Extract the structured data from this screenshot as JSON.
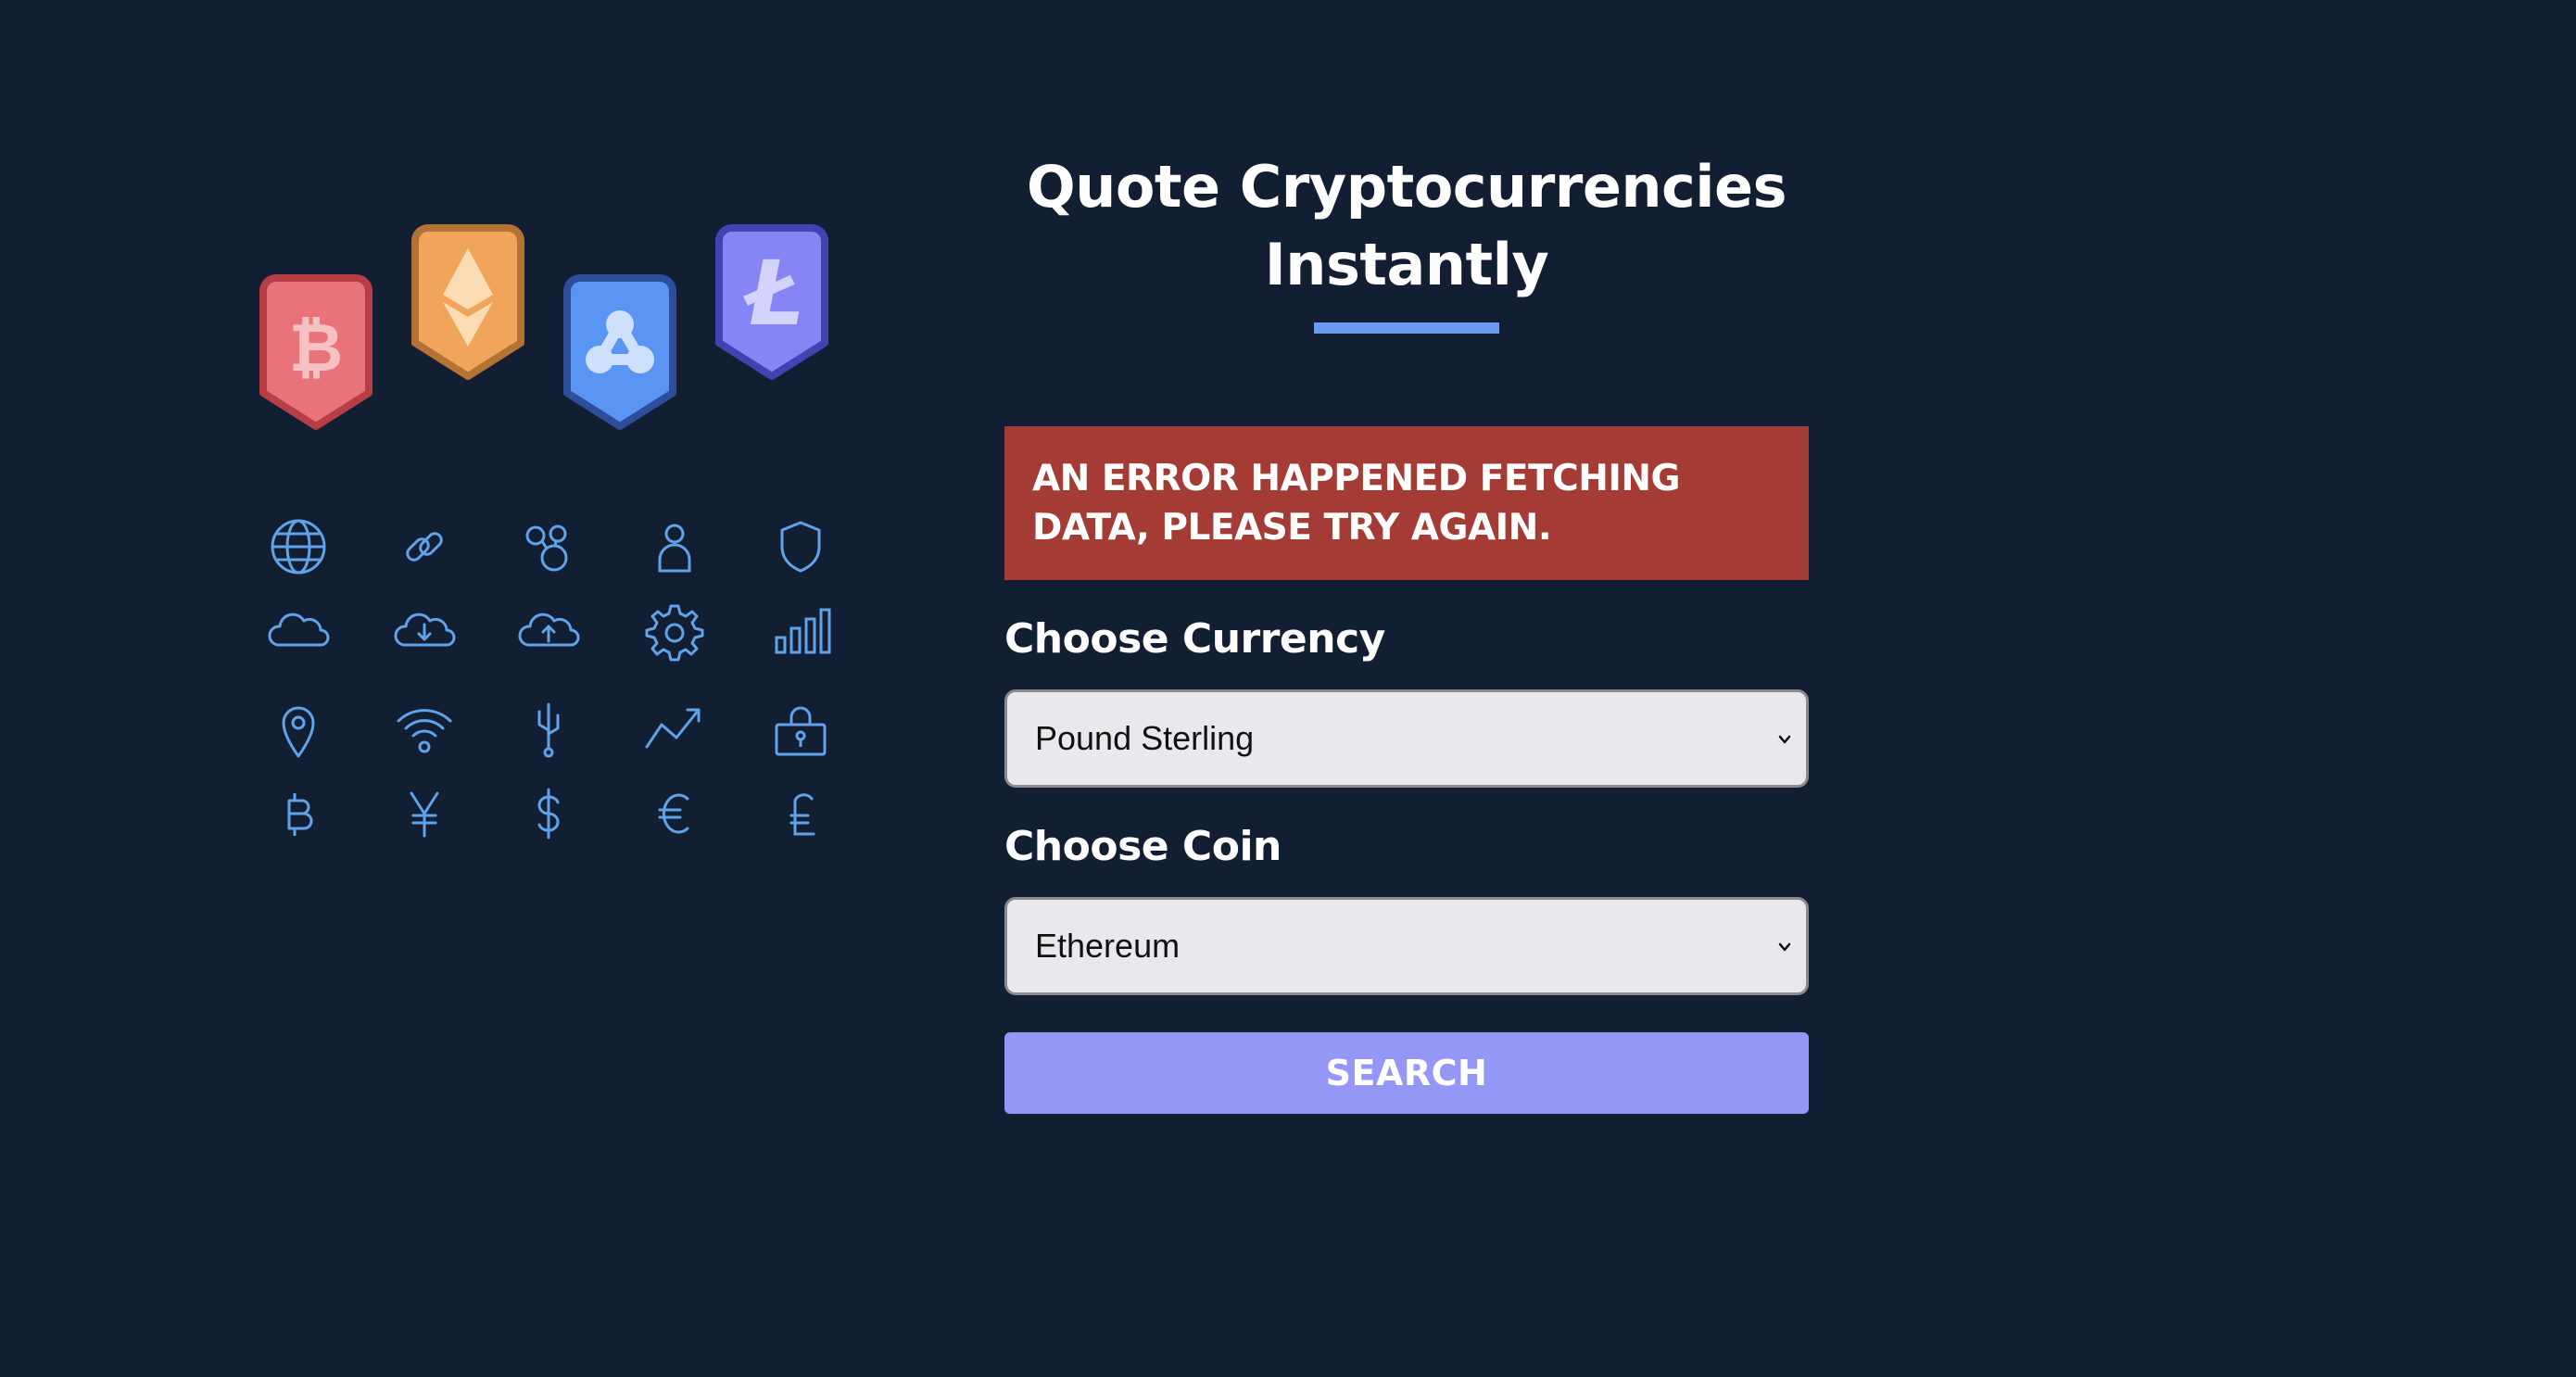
{
  "page": {
    "title_line1": "Quote Cryptocurrencies",
    "title_line2": "Instantly"
  },
  "error": {
    "message_line1": "AN ERROR HAPPENED FETCHING",
    "message_line2": "DATA, PLEASE TRY AGAIN."
  },
  "form": {
    "currency_label": "Choose Currency",
    "currency_selected": "Pound Sterling",
    "coin_label": "Choose Coin",
    "coin_selected": "Ethereum",
    "search_label": "SEARCH"
  },
  "badges": [
    {
      "name": "bitcoin-badge-icon",
      "color": "#e8737a"
    },
    {
      "name": "ethereum-badge-icon",
      "color": "#f0a55a"
    },
    {
      "name": "ripple-badge-icon",
      "color": "#5b95f3"
    },
    {
      "name": "litecoin-badge-icon",
      "color": "#8785f5"
    }
  ],
  "icon_grid": [
    [
      "globe-icon",
      "link-icon",
      "network-icon",
      "user-icon",
      "shield-icon"
    ],
    [
      "cloud-icon",
      "cloud-download-icon",
      "cloud-upload-icon",
      "gear-icon",
      "bar-chart-icon"
    ],
    [
      "location-pin-icon",
      "wifi-icon",
      "usb-icon",
      "trend-up-icon",
      "lock-icon"
    ],
    [
      "bitcoin-icon",
      "yen-icon",
      "dollar-icon",
      "euro-icon",
      "pound-icon"
    ]
  ],
  "colors": {
    "background": "#121f33",
    "accent": "#6b9bf0",
    "error": "#a53b35",
    "button": "#9497f6",
    "icon_stroke": "#5fa3ea"
  }
}
